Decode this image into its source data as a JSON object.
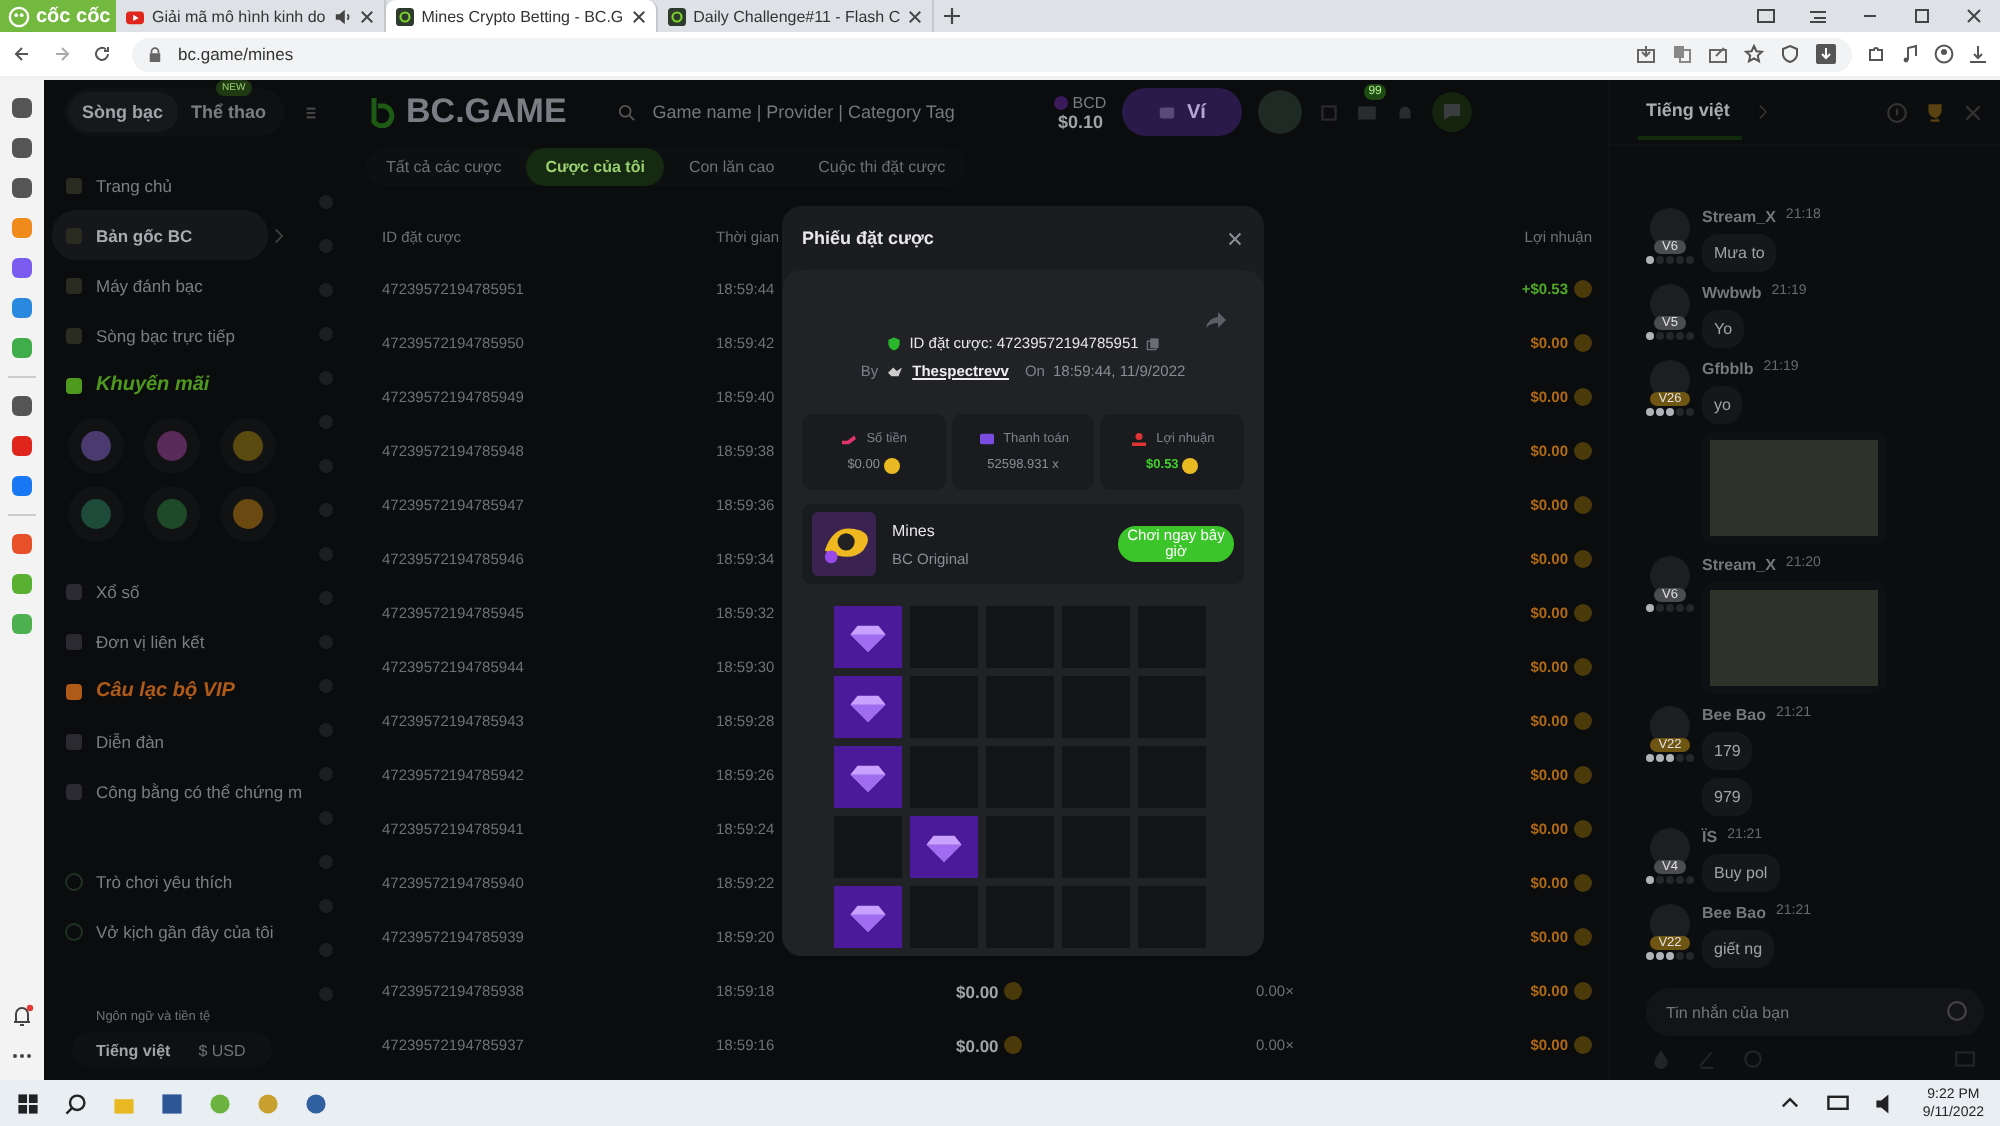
{
  "browser": {
    "brand": "cốc cốc",
    "tabs": [
      {
        "label": "Giải mã mô hình kinh do",
        "selected": false,
        "kind": "video",
        "audio": true
      },
      {
        "label": "Mines Crypto Betting - BC.G",
        "selected": true,
        "kind": "site",
        "audio": false
      },
      {
        "label": "Daily Challenge#11 - Flash C",
        "selected": false,
        "kind": "site",
        "audio": false
      }
    ],
    "url": "bc.game/mines"
  },
  "header": {
    "nav": [
      {
        "label": "Sòng bạc",
        "selected": true
      },
      {
        "label": "Thể thao",
        "selected": false,
        "badge": "NEW"
      }
    ],
    "logo": "BC.GAME",
    "search": {
      "placeholder": "Game name | Provider | Category Tag"
    },
    "currency": "BCD",
    "balance": "$0.10",
    "wallet_button": "Ví",
    "mail_count": "99"
  },
  "sidebar": {
    "top_items": [
      {
        "label": "Trang chủ",
        "kind": "link",
        "selected": false
      },
      {
        "label": "Bản gốc BC",
        "kind": "link",
        "selected": true
      },
      {
        "label": "Máy đánh bạc",
        "kind": "link",
        "selected": false
      },
      {
        "label": "Sòng bạc trực tiếp",
        "kind": "link",
        "selected": false
      },
      {
        "label": "Khuyến mãi",
        "kind": "highlight",
        "selected": false,
        "color": "#4f9a1e"
      }
    ],
    "middle_items": [
      {
        "label": "Xổ số",
        "kind": "link",
        "selected": false
      },
      {
        "label": "Đơn vị liên kết",
        "kind": "link",
        "selected": false
      },
      {
        "label": "Câu lạc bộ VIP",
        "kind": "highlight",
        "selected": false,
        "color": "#b05a18"
      },
      {
        "label": "Diễn đàn",
        "kind": "link",
        "selected": false
      },
      {
        "label": "Công bằng có thể chứng m",
        "kind": "link",
        "selected": false
      }
    ],
    "bottom_items": [
      {
        "label": "Trò chơi yêu thích",
        "selected": false
      },
      {
        "label": "Vở kịch gần đây của tôi",
        "selected": false
      }
    ],
    "locale": {
      "caption": "Ngôn ngữ và tiền tệ",
      "language": "Tiếng việt",
      "currency": "$ USD"
    }
  },
  "bets": {
    "tabs": [
      {
        "label": "Tất cả các cược",
        "selected": false
      },
      {
        "label": "Cược của tôi",
        "selected": true
      },
      {
        "label": "Con lăn cao",
        "selected": false
      },
      {
        "label": "Cuộc thi đặt cược",
        "selected": false
      }
    ],
    "columns": [
      "ID đặt cược",
      "Thời gian",
      "Lợi nhuận"
    ],
    "rows": [
      {
        "id": "47239572194785951",
        "time": "18:59:44",
        "profit": "+$0.53",
        "won": true
      },
      {
        "id": "47239572194785950",
        "time": "18:59:42",
        "profit": "$0.00",
        "won": false
      },
      {
        "id": "47239572194785949",
        "time": "18:59:40",
        "profit": "$0.00",
        "won": false
      },
      {
        "id": "47239572194785948",
        "time": "18:59:38",
        "profit": "$0.00",
        "won": false
      },
      {
        "id": "47239572194785947",
        "time": "18:59:36",
        "profit": "$0.00",
        "won": false
      },
      {
        "id": "47239572194785946",
        "time": "18:59:34",
        "profit": "$0.00",
        "won": false
      },
      {
        "id": "47239572194785945",
        "time": "18:59:32",
        "profit": "$0.00",
        "won": false
      },
      {
        "id": "47239572194785944",
        "time": "18:59:30",
        "profit": "$0.00",
        "won": false
      },
      {
        "id": "47239572194785943",
        "time": "18:59:28",
        "profit": "$0.00",
        "won": false
      },
      {
        "id": "47239572194785942",
        "time": "18:59:26",
        "profit": "$0.00",
        "won": false
      },
      {
        "id": "47239572194785941",
        "time": "18:59:24",
        "profit": "$0.00",
        "won": false
      },
      {
        "id": "47239572194785940",
        "time": "18:59:22",
        "profit": "$0.00",
        "won": false
      },
      {
        "id": "47239572194785939",
        "time": "18:59:20",
        "profit": "$0.00",
        "won": false
      },
      {
        "id": "47239572194785938",
        "time": "18:59:18",
        "amount": "$0.00",
        "multiplier": "0.00×",
        "profit": "$0.00",
        "won": false
      },
      {
        "id": "47239572194785937",
        "time": "18:59:16",
        "amount": "$0.00",
        "multiplier": "0.00×",
        "profit": "$0.00",
        "won": false
      }
    ]
  },
  "modal": {
    "title": "Phiếu đặt cược",
    "bet_id": "ID đặt cược: 47239572194785951",
    "by": "By",
    "user": "Thespectrevv",
    "on": "On",
    "datetime": "18:59:44, 11/9/2022",
    "stats": [
      {
        "kind": "amount",
        "label": "Số tiền",
        "value": "$0.00",
        "positive": false
      },
      {
        "kind": "payout",
        "label": "Thanh toán",
        "value": "52598.931 x",
        "positive": false
      },
      {
        "kind": "profit",
        "label": "Lợi nhuận",
        "value": "$0.53",
        "positive": true
      }
    ],
    "game": {
      "name": "Mines",
      "provider": "BC Original",
      "play_button": "Chơi ngay bây giờ"
    },
    "grid": [
      [
        {
          "gem": true
        },
        {
          "gem": false
        },
        {
          "gem": false
        },
        {
          "gem": false
        },
        {
          "gem": false
        }
      ],
      [
        {
          "gem": true
        },
        {
          "gem": false
        },
        {
          "gem": false
        },
        {
          "gem": false
        },
        {
          "gem": false
        }
      ],
      [
        {
          "gem": true
        },
        {
          "gem": false
        },
        {
          "gem": false
        },
        {
          "gem": false
        },
        {
          "gem": false
        }
      ],
      [
        {
          "gem": false
        },
        {
          "gem": true
        },
        {
          "gem": false
        },
        {
          "gem": false
        },
        {
          "gem": false
        }
      ],
      [
        {
          "gem": true
        },
        {
          "gem": false
        },
        {
          "gem": false
        },
        {
          "gem": false
        },
        {
          "gem": false
        }
      ]
    ]
  },
  "chat": {
    "language": "Tiếng việt",
    "messages": [
      {
        "user": "Stream_X",
        "time": "21:18",
        "level": "V6",
        "color": "#4a4c50",
        "stars": 1,
        "items": [
          {
            "kind": "text",
            "text": "Mưa to"
          }
        ]
      },
      {
        "user": "Wwbwb",
        "time": "21:19",
        "level": "V5",
        "color": "#4a4c50",
        "stars": 1,
        "items": [
          {
            "kind": "text",
            "text": "Yo"
          }
        ]
      },
      {
        "user": "Gfbblb",
        "time": "21:19",
        "level": "V26",
        "color": "#6e5512",
        "stars": 3,
        "items": [
          {
            "kind": "text",
            "text": "yo"
          },
          {
            "kind": "image"
          }
        ]
      },
      {
        "user": "Stream_X",
        "time": "21:20",
        "level": "V6",
        "color": "#4a4c50",
        "stars": 1,
        "items": [
          {
            "kind": "image"
          }
        ]
      },
      {
        "user": "Bee Bao",
        "time": "21:21",
        "level": "V22",
        "color": "#6e5512",
        "stars": 3,
        "items": [
          {
            "kind": "text",
            "text": "179"
          },
          {
            "kind": "text",
            "text": "979"
          }
        ]
      },
      {
        "user": "ÏS",
        "time": "21:21",
        "level": "V4",
        "color": "#4a4c50",
        "stars": 1,
        "items": [
          {
            "kind": "text",
            "text": "Buy pol"
          }
        ]
      },
      {
        "user": "Bee Bao",
        "time": "21:21",
        "level": "V22",
        "color": "#6e5512",
        "stars": 3,
        "items": [
          {
            "kind": "text",
            "text": "giết ng"
          }
        ]
      }
    ],
    "input": {
      "placeholder": "Tin nhắn của bạn"
    }
  },
  "taskbar": {
    "time": "9:22 PM",
    "date": "9/11/2022"
  }
}
